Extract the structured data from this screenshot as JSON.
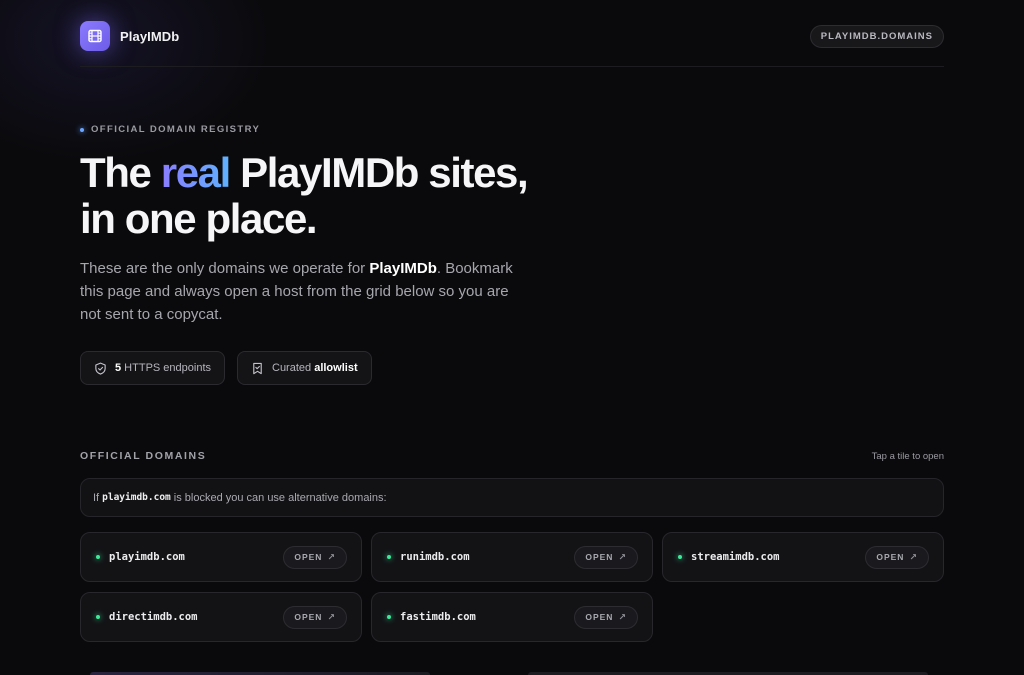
{
  "header": {
    "brand_name": "PlayIMDb",
    "domains_pill": "PLAYIMDB.DOMAINS"
  },
  "hero": {
    "eyebrow": "OFFICIAL DOMAIN REGISTRY",
    "title_pre": "The ",
    "title_accent": "real",
    "title_post": " PlayIMDb sites,",
    "title_line2": "in one place.",
    "lead_pre": "These are the only domains we operate for ",
    "lead_brand": "PlayIMDb",
    "lead_post": ". Bookmark this page and always open a host from the grid below so you are not sent to a copycat.",
    "chips": [
      {
        "icon": "shield-icon",
        "bold": "5",
        "text": " HTTPS endpoints"
      },
      {
        "icon": "bookmark-check-icon",
        "text": "Curated ",
        "bold": "allowlist"
      }
    ]
  },
  "domains_section": {
    "title": "OFFICIAL DOMAINS",
    "hint": "Tap a tile to open",
    "notice_pre": "If",
    "notice_code": "playimdb.com",
    "notice_post": "is blocked you can use alternative domains:",
    "open_label": "OPEN",
    "tiles": [
      {
        "domain": "playimdb.com"
      },
      {
        "domain": "runimdb.com"
      },
      {
        "domain": "streamimdb.com"
      },
      {
        "domain": "directimdb.com"
      },
      {
        "domain": "fastimdb.com"
      }
    ]
  },
  "colors": {
    "accent_start": "#8a7dff",
    "accent_end": "#5fb2ff",
    "status_green": "#3ee89a",
    "background": "#0a0a0c"
  }
}
